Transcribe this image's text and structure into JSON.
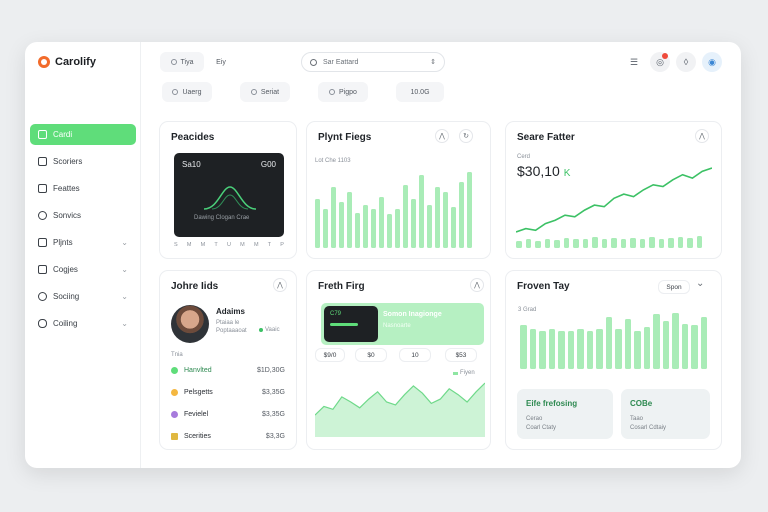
{
  "app": {
    "name": "Carolify"
  },
  "sidebar": {
    "items": [
      {
        "label": "Cardi",
        "active": true
      },
      {
        "label": "Scoriers"
      },
      {
        "label": "Feattes"
      },
      {
        "label": "Sonvics"
      },
      {
        "label": "Pljnts",
        "expandable": true
      },
      {
        "label": "Cogjes",
        "expandable": true
      },
      {
        "label": "Sociing",
        "expandable": true
      },
      {
        "label": "Coiling",
        "expandable": true
      }
    ]
  },
  "header": {
    "tab_one": "Tiya",
    "tab_two": "Eiy",
    "search_value": "Sar Eattard",
    "sort_glyph": "⇕",
    "filters": [
      "Uaerg",
      "Seriat",
      "Pigpo",
      "10.0G"
    ]
  },
  "cards": {
    "peacides": {
      "title": "Peacides",
      "card_left": "Sa10",
      "card_right": "G00",
      "card_caption": "Dawing Clogan Crae",
      "day_labels": [
        "S",
        "M",
        "M",
        "T",
        "U",
        "M",
        "M",
        "T",
        "P"
      ]
    },
    "plynt": {
      "title": "Plynt Fiegs",
      "subtitle": "Lot Che 1103",
      "values": [
        48,
        38,
        60,
        45,
        55,
        35,
        42,
        38,
        50,
        34,
        38,
        62,
        48,
        72,
        42,
        60,
        55,
        40,
        65,
        75
      ]
    },
    "seare": {
      "title": "Seare Fatter",
      "label": "Cerd",
      "value": "$30,10",
      "unit": "K",
      "line": [
        10,
        14,
        12,
        20,
        24,
        30,
        28,
        36,
        42,
        40,
        50,
        55,
        52,
        60,
        66,
        64,
        72,
        78,
        74,
        82,
        86
      ],
      "bars": [
        8,
        10,
        8,
        11,
        9,
        12,
        10,
        11,
        13,
        10,
        12,
        11,
        12,
        10,
        13,
        11,
        12,
        13,
        12,
        14
      ]
    },
    "johre": {
      "title": "Johre Iids",
      "person_name": "Adaims",
      "person_meta_one": "Ptaiaa le",
      "person_meta_two": "Poptaaaoat",
      "person_badge": "Vaaic",
      "section_label": "Tnia",
      "rows": [
        {
          "label": "Hanvlted",
          "amount": "$1D,30G",
          "color": "#5fdd7a"
        },
        {
          "label": "Pelsgetts",
          "amount": "$3,35G",
          "color": "#f4b740"
        },
        {
          "label": "Fevielel",
          "amount": "$3,35G",
          "color": "#a77bdc"
        },
        {
          "label": "Scerities",
          "amount": "$3,3G",
          "color": "#e0b840"
        }
      ]
    },
    "fresh": {
      "title": "Freth Firg",
      "card_tag": "C79",
      "banner_title": "Somon Inagionge",
      "banner_sub": "Nasnoarte",
      "chips": [
        "$9/0",
        "$0",
        "10",
        "$53"
      ],
      "legend": "Fiyen",
      "area": [
        30,
        42,
        38,
        55,
        48,
        40,
        52,
        62,
        48,
        44,
        58,
        70,
        60,
        46,
        52,
        66,
        58,
        48,
        62,
        74
      ]
    },
    "froven": {
      "title": "Froven Tay",
      "chip": "Spon",
      "axis_top": "3",
      "axis_label": "Grad",
      "values": [
        44,
        40,
        38,
        40,
        38,
        38,
        40,
        38,
        40,
        52,
        40,
        50,
        38,
        42,
        55,
        48,
        56,
        45,
        44,
        52
      ],
      "mini_one": {
        "title": "Eife frefosing",
        "line1": "Cerao",
        "line2": "Coarl Ctaty"
      },
      "mini_two": {
        "title": "COBe",
        "line1": "Taao",
        "line2": "Cosarl Cdtaiy"
      }
    }
  }
}
